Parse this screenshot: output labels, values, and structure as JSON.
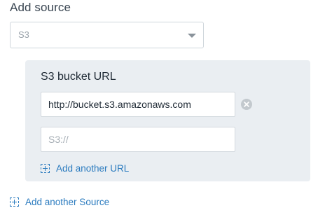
{
  "header": {
    "title": "Add source"
  },
  "source_select": {
    "selected": "S3"
  },
  "s3_panel": {
    "title": "S3 bucket URL",
    "urls": [
      {
        "value": "http://bucket.s3.amazonaws.com",
        "placeholder": ""
      },
      {
        "value": "",
        "placeholder": "S3://"
      }
    ],
    "add_url_label": "Add another URL"
  },
  "footer": {
    "add_source_label": "Add another Source"
  },
  "icons": {
    "clear": "close-circle-icon",
    "add": "plus-icon",
    "dropdown": "caret-down-icon"
  },
  "colors": {
    "link": "#2b7bbf",
    "panel_background": "#eaeef2"
  }
}
